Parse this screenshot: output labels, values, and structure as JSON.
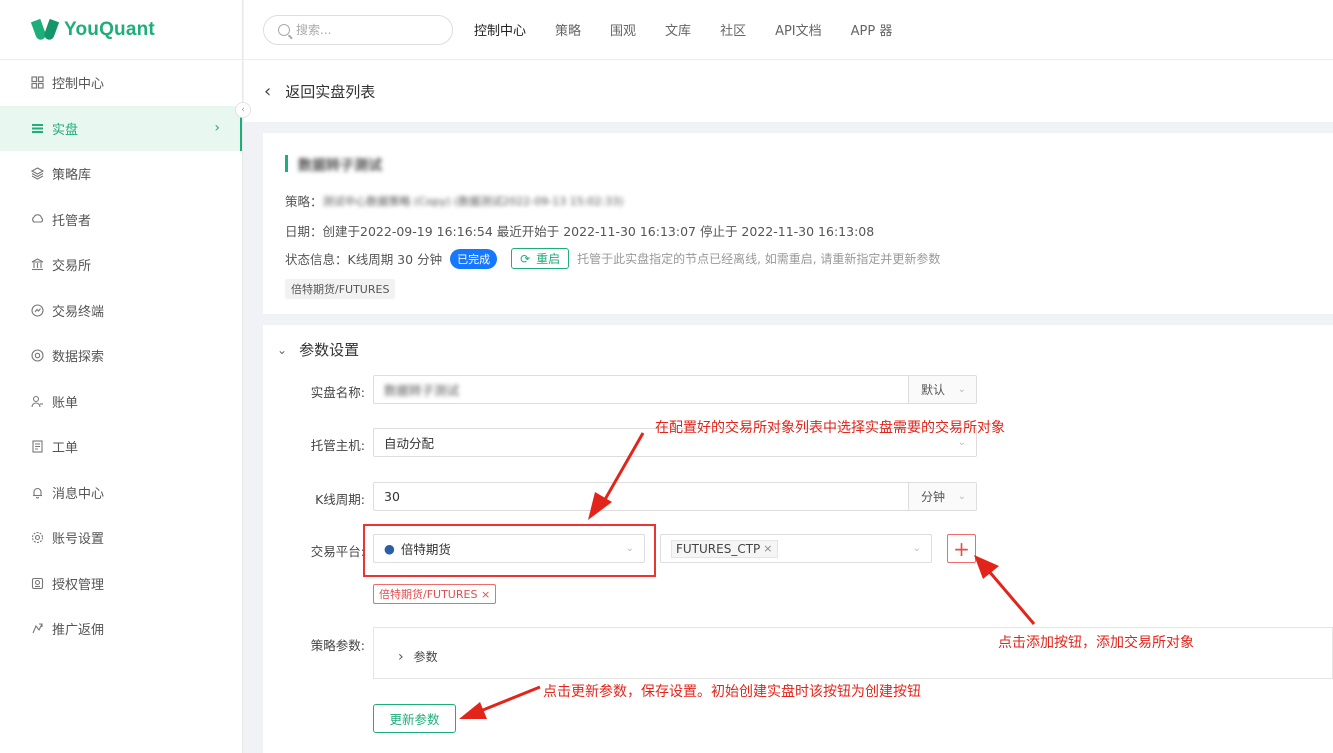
{
  "brand": {
    "name": "YouQuant"
  },
  "sidebar": {
    "items": [
      {
        "label": "控制中心",
        "icon": "dashboard-icon"
      },
      {
        "label": "实盘",
        "icon": "live-trading-icon"
      },
      {
        "label": "策略库",
        "icon": "strategy-library-icon"
      },
      {
        "label": "托管者",
        "icon": "docker-icon"
      },
      {
        "label": "交易所",
        "icon": "bank-icon"
      },
      {
        "label": "交易终端",
        "icon": "terminal-icon"
      },
      {
        "label": "数据探索",
        "icon": "data-explore-icon"
      },
      {
        "label": "账单",
        "icon": "bill-icon"
      },
      {
        "label": "工单",
        "icon": "ticket-icon"
      },
      {
        "label": "消息中心",
        "icon": "bell-icon"
      },
      {
        "label": "账号设置",
        "icon": "settings-icon"
      },
      {
        "label": "授权管理",
        "icon": "license-icon"
      },
      {
        "label": "推广返佣",
        "icon": "share-icon"
      }
    ],
    "active_index": 1
  },
  "topbar": {
    "search_placeholder": "搜索...",
    "nav": [
      "控制中心",
      "策略",
      "围观",
      "文库",
      "社区",
      "API文档",
      "APP 器"
    ]
  },
  "back_bar": {
    "label": "返回实盘列表"
  },
  "live": {
    "title": "数据转子测试",
    "strategy_label": "策略：",
    "strategy_value": "测试中心数据策略 (Copy) (数据测试2022-09-13 15:02:33)",
    "date_label": "日期：",
    "date_value": "创建于2022-09-19 16:16:54 最近开始于 2022-11-30 16:13:07 停止于 2022-11-30 16:13:08",
    "status_label": "状态信息：",
    "status_value": "K线周期 30 分钟",
    "status_badge": "已完成",
    "restart_label": "重启",
    "hint": "托管于此实盘指定的节点已经离线, 如需重启, 请重新指定并更新参数",
    "exchange_tag": "倍特期货/FUTURES"
  },
  "params": {
    "section_title": "参数设置",
    "name_label": "实盘名称:",
    "name_value": "数据转子测试",
    "name_suffix": "默认",
    "host_label": "托管主机:",
    "host_value": "自动分配",
    "kline_label": "K线周期:",
    "kline_value": "30",
    "kline_suffix": "分钟",
    "platform_label": "交易平台:",
    "platform_value": "倍特期货",
    "platform_chip": "FUTURES_CTP",
    "platform_tag": "倍特期货/FUTURES",
    "strategy_params_label": "策略参数:",
    "strategy_params_toggle": "参数",
    "update_button": "更新参数"
  },
  "annotations": {
    "a1": "在配置好的交易所对象列表中选择实盘需要的交易所对象",
    "a2": "点击添加按钮，添加交易所对象",
    "a3": "点击更新参数，保存设置。初始创建实盘时该按钮为创建按钮",
    "color": "#e3241b"
  },
  "colors": {
    "accent": "#1eae7a",
    "badge_blue": "#1677ff",
    "red": "#e3241b"
  }
}
